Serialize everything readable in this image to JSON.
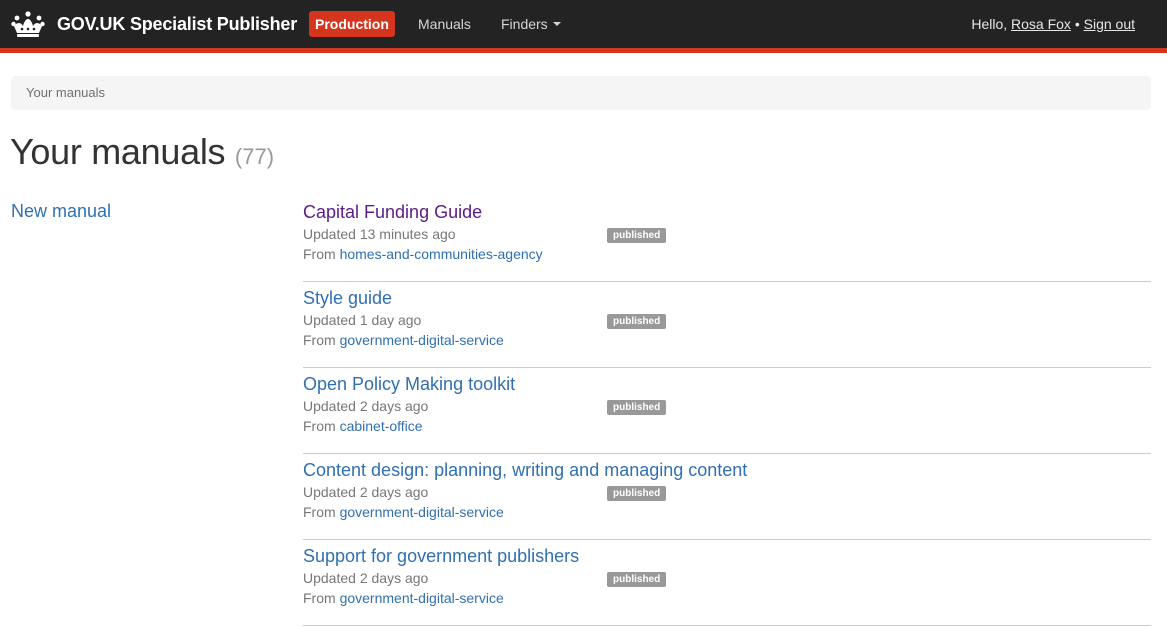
{
  "header": {
    "brand": "GOV.UK Specialist Publisher",
    "environment": "Production",
    "nav": {
      "manuals": "Manuals",
      "finders": "Finders"
    },
    "user": {
      "greeting": "Hello,",
      "name": "Rosa Fox",
      "separator": "•",
      "sign_out": "Sign out"
    },
    "colors": {
      "bar": "#232323",
      "accent": "#d4351c"
    }
  },
  "breadcrumb": "Your manuals",
  "page": {
    "title": "Your manuals",
    "count": "(77)"
  },
  "sidebar": {
    "new_manual": "New manual"
  },
  "manuals": [
    {
      "title": "Capital Funding Guide",
      "updated": "Updated 13 minutes ago",
      "from_label": "From",
      "organisation": "homes-and-communities-agency",
      "state": "published",
      "visited": true
    },
    {
      "title": "Style guide",
      "updated": "Updated 1 day ago",
      "from_label": "From",
      "organisation": "government-digital-service",
      "state": "published",
      "visited": false
    },
    {
      "title": "Open Policy Making toolkit",
      "updated": "Updated 2 days ago",
      "from_label": "From",
      "organisation": "cabinet-office",
      "state": "published",
      "visited": false
    },
    {
      "title": "Content design: planning, writing and managing content",
      "updated": "Updated 2 days ago",
      "from_label": "From",
      "organisation": "government-digital-service",
      "state": "published",
      "visited": false
    },
    {
      "title": "Support for government publishers",
      "updated": "Updated 2 days ago",
      "from_label": "From",
      "organisation": "government-digital-service",
      "state": "published",
      "visited": false
    }
  ]
}
